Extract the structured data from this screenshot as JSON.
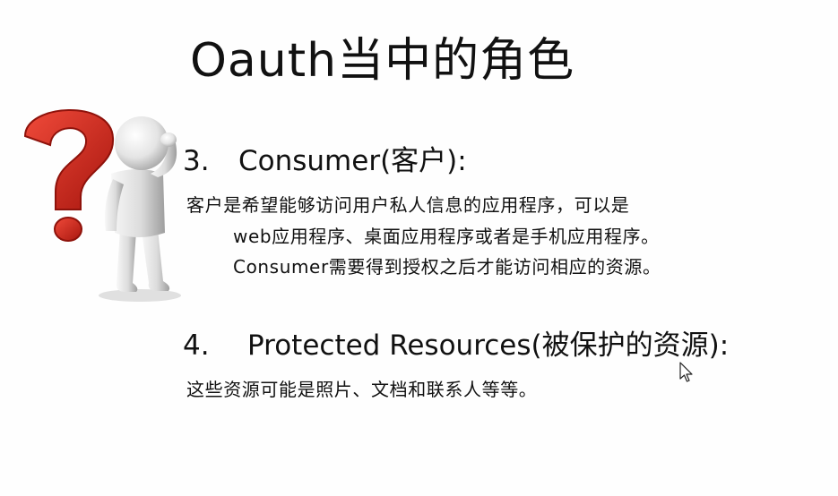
{
  "slide": {
    "title": "Oauth当中的角色",
    "section3": {
      "number": "3.",
      "heading": "Consumer(客户):",
      "lines": [
        "客户是希望能够访问用户私人信息的应用程序，可以是",
        "web应用程序、桌面应用程序或者是手机应用程序。",
        "Consumer需要得到授权之后才能访问相应的资源。"
      ]
    },
    "section4": {
      "number": "4.",
      "heading": "Protected Resources(被保护的资源):",
      "lines": [
        "这些资源可能是照片、文档和联系人等等。"
      ]
    }
  },
  "illustration": {
    "icon": "thinking-figure-question-mark-icon",
    "question_mark_color": "#d62b1f",
    "figure_color": "#e6e6e6"
  },
  "cursor": {
    "icon": "mouse-pointer-icon"
  }
}
